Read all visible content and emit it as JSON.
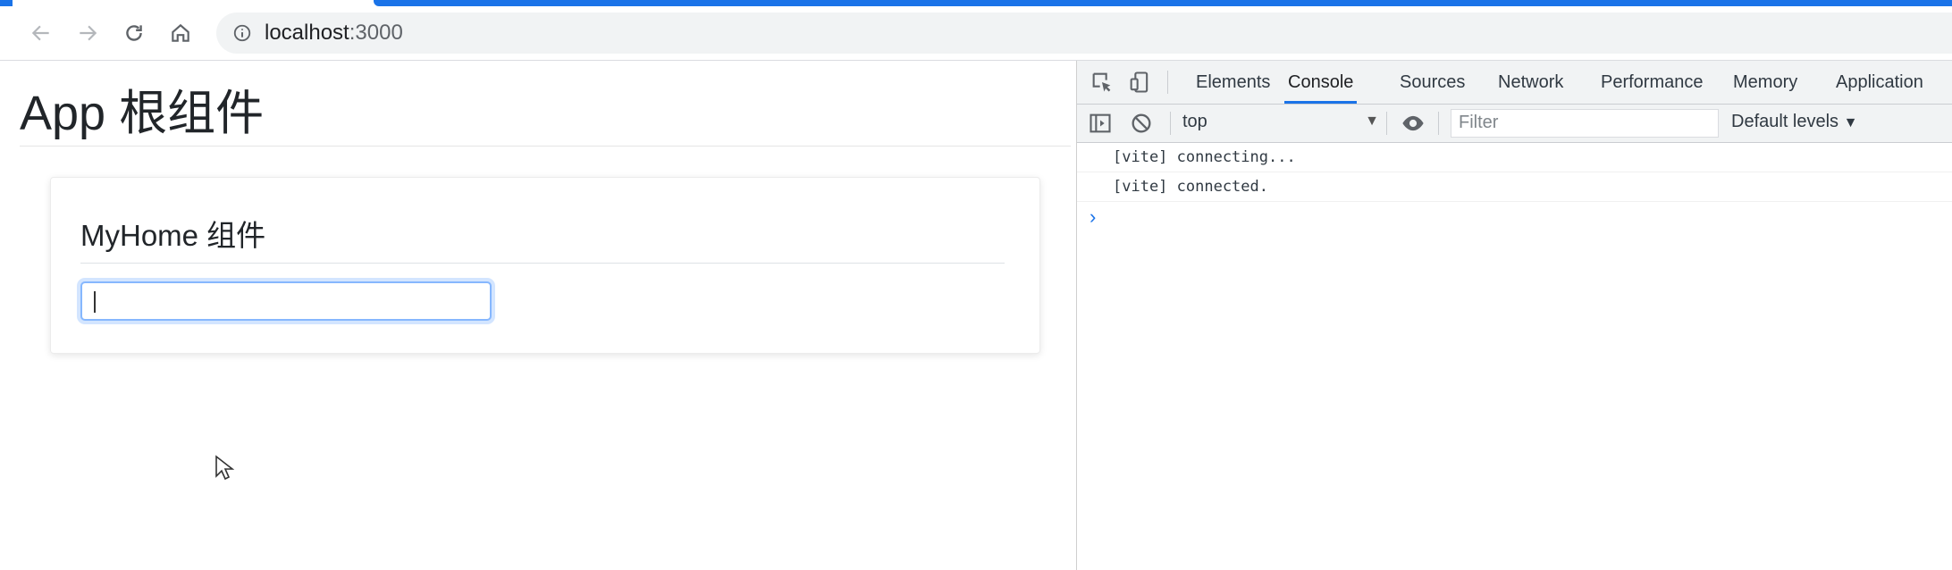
{
  "browser": {
    "url_host": "localhost",
    "url_port": ":3000"
  },
  "page": {
    "app_title": "App 根组件",
    "card_title": "MyHome 组件",
    "input_value": ""
  },
  "devtools": {
    "tabs": [
      {
        "label": "Elements"
      },
      {
        "label": "Console",
        "active": true
      },
      {
        "label": "Sources"
      },
      {
        "label": "Network"
      },
      {
        "label": "Performance"
      },
      {
        "label": "Memory"
      },
      {
        "label": "Application"
      }
    ],
    "context": "top",
    "filter_placeholder": "Filter",
    "levels": "Default levels",
    "console_messages": [
      "[vite] connecting...",
      "[vite] connected."
    ],
    "prompt_symbol": "›"
  },
  "colors": {
    "accent": "#1a73e8",
    "input_focus": "#86b7fe"
  },
  "icons": [
    "back-arrow-icon",
    "forward-arrow-icon",
    "reload-icon",
    "home-icon",
    "info-icon",
    "inspect-icon",
    "device-toolbar-icon",
    "sidebar-toggle-icon",
    "clear-console-icon",
    "eye-icon",
    "mouse-cursor-icon"
  ]
}
